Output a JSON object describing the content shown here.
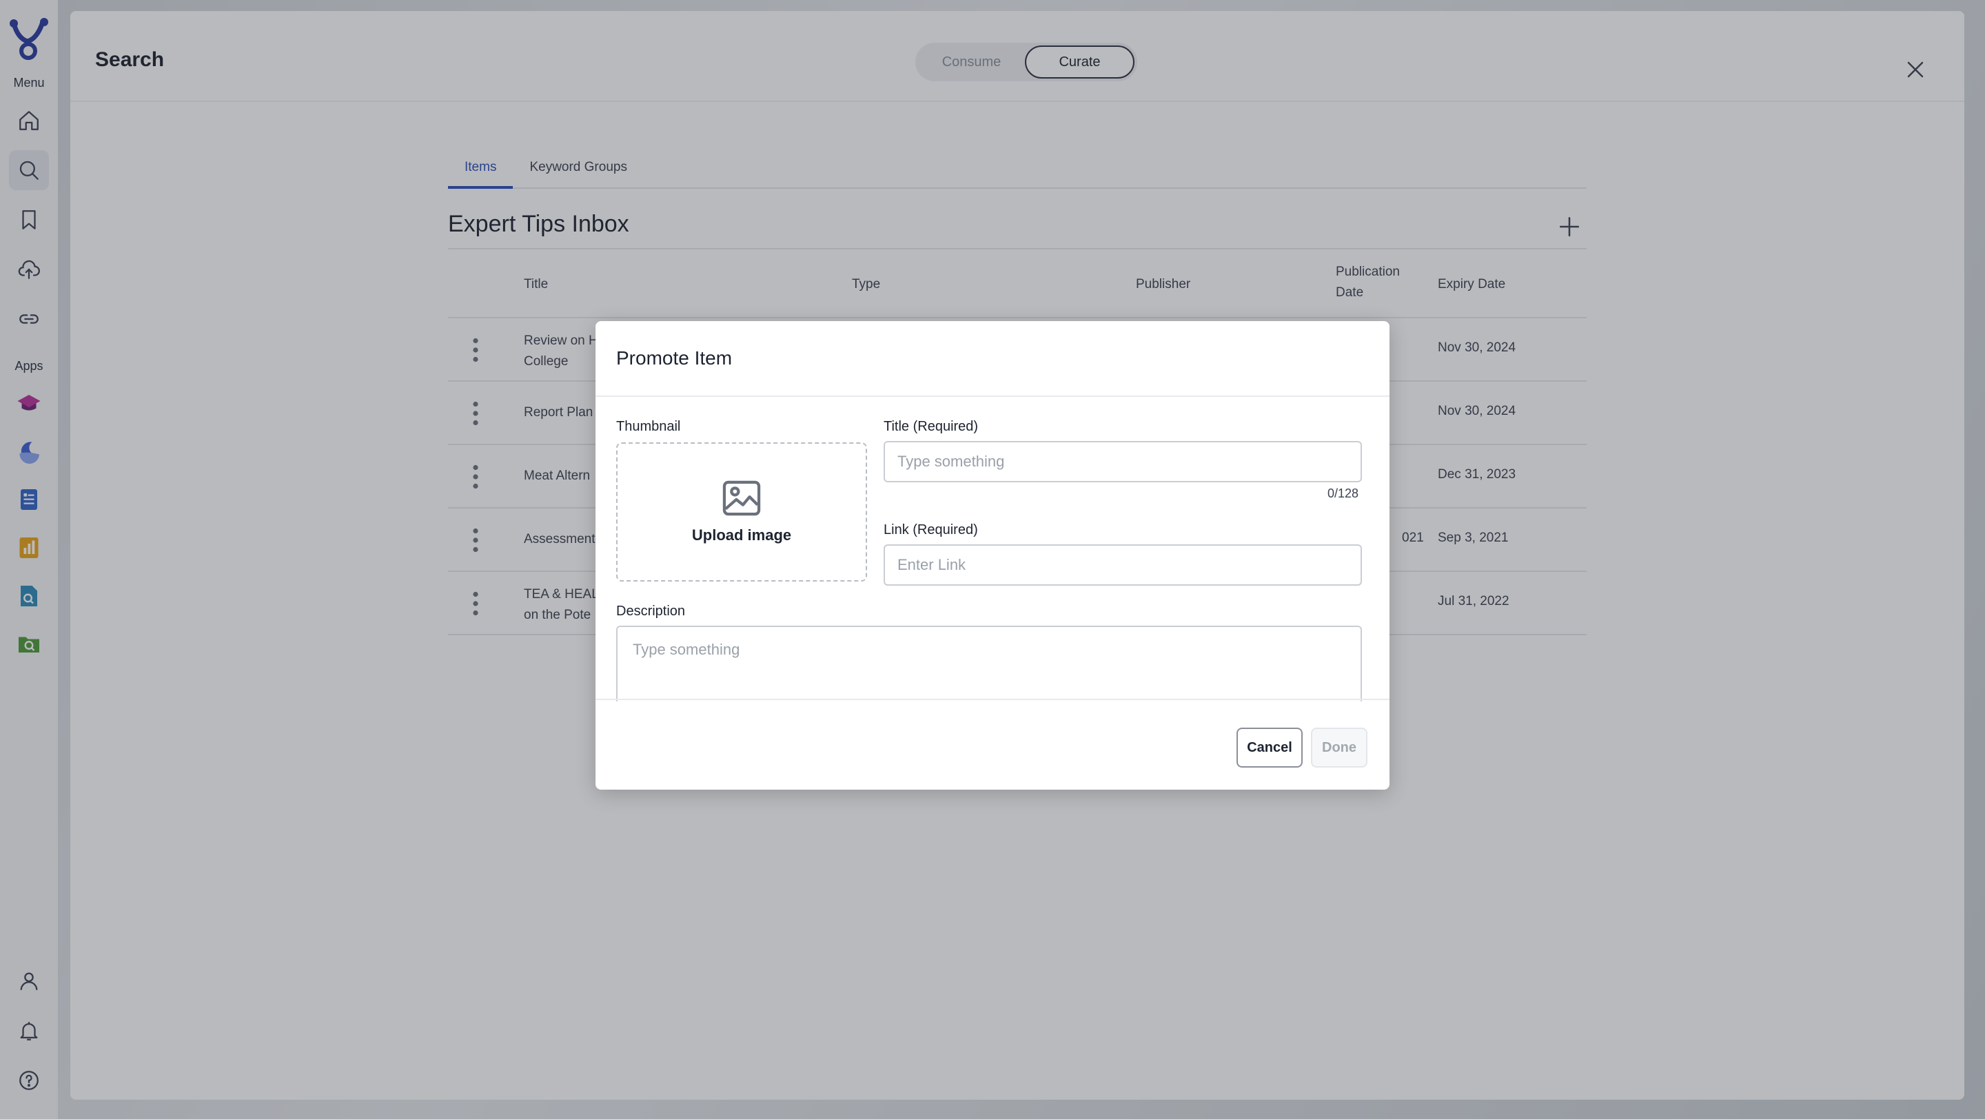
{
  "rail": {
    "menu_label": "Menu",
    "apps_label": "Apps",
    "menu_items": [
      "home-icon",
      "search-icon",
      "bookmark-icon",
      "upload-cloud-icon",
      "link-icon"
    ],
    "apps": [
      "graduation-cap-icon",
      "moon-icon",
      "document-list-icon",
      "bar-chart-icon",
      "document-search-icon",
      "folder-search-icon"
    ],
    "bottom_items": [
      "user-icon",
      "bell-icon",
      "help-icon"
    ],
    "accent_color": "#2a3a9e"
  },
  "header": {
    "title": "Search",
    "toggle": {
      "consume": "Consume",
      "curate": "Curate",
      "selected": "Curate"
    }
  },
  "tabs": [
    {
      "label": "Items",
      "active": true
    },
    {
      "label": "Keyword Groups",
      "active": false
    }
  ],
  "section": {
    "title": "Expert Tips Inbox"
  },
  "table": {
    "columns": {
      "title": "Title",
      "type": "Type",
      "publisher": "Publisher",
      "publication_date_1": "Publication",
      "publication_date_2": "Date",
      "expiry_date": "Expiry Date"
    },
    "rows": [
      {
        "title_1": "Review on H",
        "title_2": "College",
        "pub": "",
        "expiry": "Nov 30, 2024"
      },
      {
        "title_1": "Report Plan",
        "title_2": "",
        "pub": "",
        "expiry": "Nov 30, 2024"
      },
      {
        "title_1": "Meat Altern",
        "title_2": "",
        "pub": "",
        "expiry": "Dec 31, 2023"
      },
      {
        "title_1": "Assessment",
        "title_2": "",
        "pub": "021",
        "expiry": "Sep 3, 2021"
      },
      {
        "title_1": "TEA & HEAL",
        "title_2": "on the Pote",
        "pub": "",
        "expiry": "Jul 31, 2022"
      }
    ]
  },
  "modal": {
    "title": "Promote Item",
    "thumbnail_label": "Thumbnail",
    "upload_label": "Upload image",
    "title_field_label": "Title (Required)",
    "title_placeholder": "Type something",
    "title_value": "",
    "title_counter": "0/128",
    "link_label": "Link (Required)",
    "link_placeholder": "Enter Link",
    "link_value": "",
    "description_label": "Description",
    "description_placeholder": "Type something",
    "cancel_label": "Cancel",
    "done_label": "Done"
  }
}
